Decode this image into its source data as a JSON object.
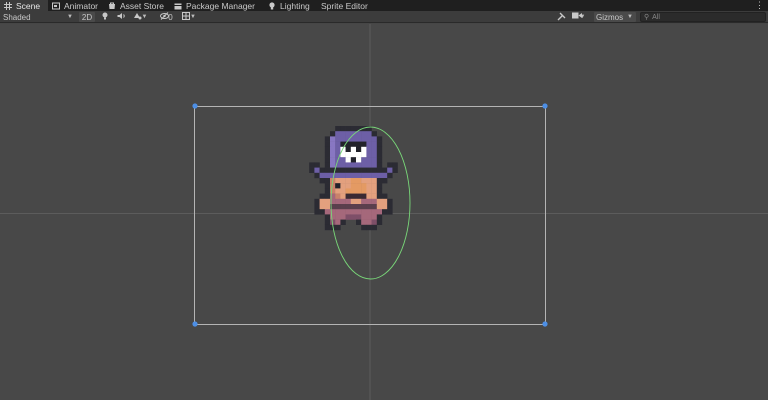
{
  "tabs": [
    {
      "label": "Scene",
      "icon": "grid-icon",
      "active": true
    },
    {
      "label": "Animator",
      "icon": "animator-icon",
      "active": false
    },
    {
      "label": "Asset Store",
      "icon": "store-icon",
      "active": false
    },
    {
      "label": "Package Manager",
      "icon": "package-icon",
      "active": false
    },
    {
      "label": "Lighting",
      "icon": "light-icon",
      "active": false
    },
    {
      "label": "Sprite Editor",
      "icon": "",
      "active": false
    }
  ],
  "toolbar": {
    "draw_mode": "Shaded",
    "mode_2d": "2D",
    "hidden_count": "0",
    "gizmos": "Gizmos",
    "search_placeholder": "All"
  },
  "colors": {
    "tab_bg": "#1f1f1f",
    "toolbar_bg": "#3c3c3c",
    "viewport_bg": "#484848",
    "rect_outline": "#b4b4b4",
    "handle": "#4d8fe6",
    "collider": "#79d779",
    "hat": "#6d5fa6",
    "skin": "#e3a07e"
  }
}
